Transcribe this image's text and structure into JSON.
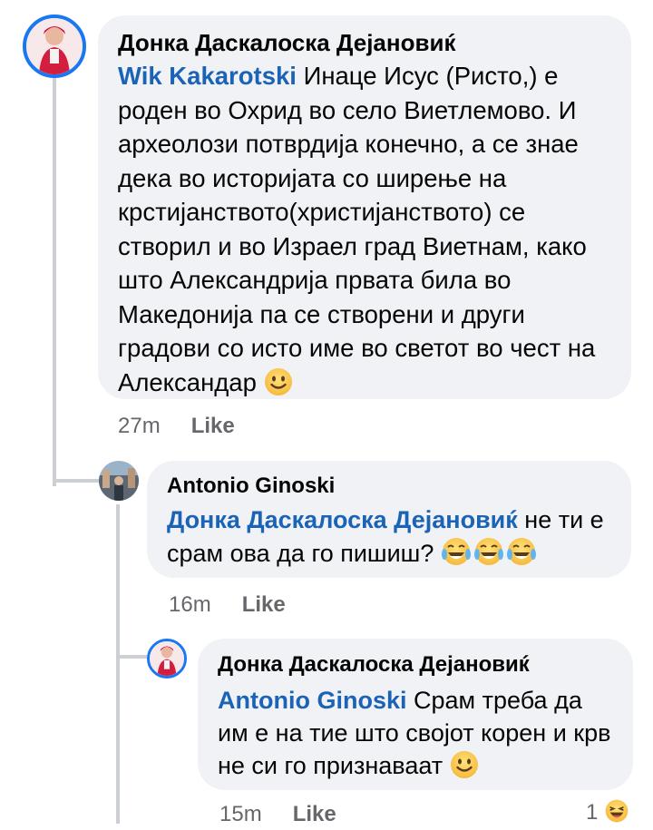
{
  "comments": [
    {
      "author": "Донка Даскалоска Дејановиќ",
      "mention": "Wik Kakarotski",
      "text": "Инаце Исус (Ристо,) е роден во Охрид во село Виетлемово. И археолози потврдија конечно, а се знае дека во историјата со ширење на крстијанството(христијанството) се створил и во Израел град Виетнам, како што Александрија првата била во Македонија па се створени и други градови со исто име во светот во чест на Александар",
      "emoji": "slightly-smiling-face-icon",
      "time": "27m",
      "like": "Like"
    },
    {
      "author": "Antonio Ginoski",
      "mention": "Донка Даскалоска Дејановиќ",
      "text": "не ти е срам ова да го пишиш?",
      "emoji": "tears-of-joy-icon",
      "time": "16m",
      "like": "Like"
    },
    {
      "author": "Донка Даскалоска Дејановиќ",
      "mention": "Antonio Ginoski",
      "text": "Срам треба да им е на тие што својот корен и крв не си го признаваат",
      "emoji": "slightly-smiling-face-icon",
      "time": "15m",
      "like": "Like",
      "reaction_count": "1",
      "reaction_icon": "laughing-reaction-icon"
    }
  ],
  "colors": {
    "mention": "#1b63b6",
    "bubble": "#f0f2f5",
    "meta": "#65676b",
    "avatar_ring": "#1877f2"
  }
}
